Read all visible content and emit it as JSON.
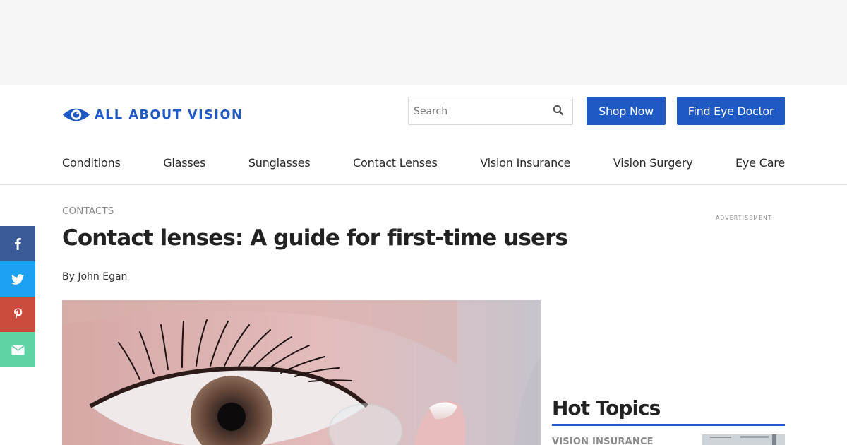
{
  "header": {
    "logo_text": "ALL ABOUT VISION",
    "search_placeholder": "Search",
    "shop_button": "Shop Now",
    "doctor_button": "Find Eye Doctor",
    "brand_color": "#1f59c4"
  },
  "nav": {
    "items": [
      "Conditions",
      "Glasses",
      "Sunglasses",
      "Contact Lenses",
      "Vision Insurance",
      "Vision Surgery",
      "Eye Care"
    ]
  },
  "social": {
    "items": [
      {
        "icon": "facebook-icon",
        "color": "#3b5b98"
      },
      {
        "icon": "twitter-icon",
        "color": "#1da1f2"
      },
      {
        "icon": "pinterest-icon",
        "color": "#cb4b3c"
      },
      {
        "icon": "email-icon",
        "color": "#5fd3a4"
      }
    ]
  },
  "article": {
    "category": "CONTACTS",
    "title": "Contact lenses: A guide for first-time users",
    "byline": "By John Egan"
  },
  "sidebar": {
    "ad_label": "ADVERTISEMENT",
    "hot_topics_title": "Hot Topics",
    "first_topic_category": "VISION INSURANCE"
  }
}
